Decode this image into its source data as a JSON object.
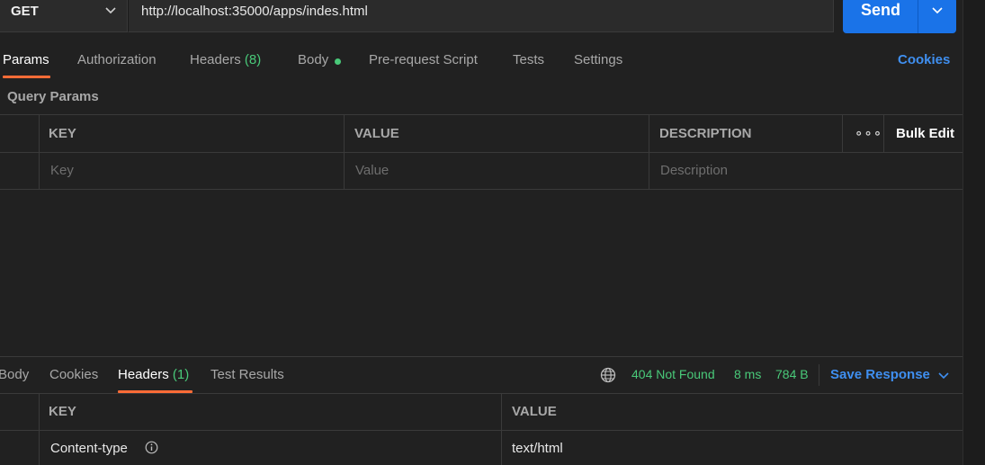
{
  "request": {
    "method": "GET",
    "url": "http://localhost:35000/apps/indes.html",
    "send_label": "Send"
  },
  "request_tabs": {
    "params": "Params",
    "authorization": "Authorization",
    "headers": "Headers",
    "headers_count": "(8)",
    "body": "Body",
    "prerequest": "Pre-request Script",
    "tests": "Tests",
    "settings": "Settings",
    "cookies": "Cookies"
  },
  "query_params": {
    "title": "Query Params",
    "columns": {
      "key": "KEY",
      "value": "VALUE",
      "description": "DESCRIPTION"
    },
    "more": "∘∘∘",
    "bulk_edit": "Bulk Edit",
    "placeholders": {
      "key": "Key",
      "value": "Value",
      "description": "Description"
    }
  },
  "response_tabs": {
    "body": "Body",
    "cookies": "Cookies",
    "headers": "Headers",
    "headers_count": "(1)",
    "test_results": "Test Results"
  },
  "response_status": {
    "status": "404 Not Found",
    "time": "8 ms",
    "size": "784 B",
    "save_label": "Save Response"
  },
  "response_headers": {
    "columns": {
      "key": "KEY",
      "value": "VALUE"
    },
    "rows": [
      {
        "key": "Content-type",
        "value": "text/html"
      }
    ]
  },
  "colors": {
    "accent_orange": "#ff6c37",
    "send_blue": "#1a73e8",
    "link_blue": "#3f8ff0",
    "status_green": "#49c979"
  }
}
